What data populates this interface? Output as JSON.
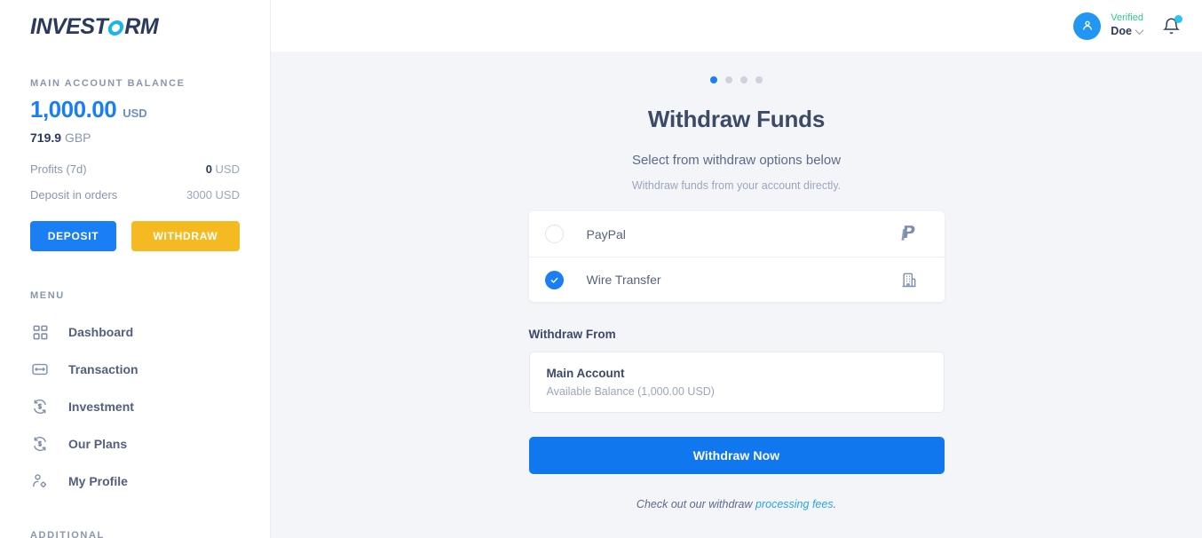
{
  "sidebar": {
    "logo": {
      "before": "INVEST",
      "ring": "O",
      "after": "RM"
    },
    "balance": {
      "label": "MAIN ACCOUNT BALANCE",
      "amount": "1,000.00",
      "currency": "USD",
      "secondary_amount": "719.9",
      "secondary_currency": "GBP"
    },
    "stats": [
      {
        "key": "Profits (7d)",
        "value": "0",
        "unit": "USD",
        "bold_value": true
      },
      {
        "key": "Deposit in orders",
        "value": "3000 USD",
        "unit": "",
        "bold_value": false
      }
    ],
    "actions": {
      "deposit": "DEPOSIT",
      "withdraw": "WITHDRAW"
    },
    "menu_label": "MENU",
    "menu": [
      {
        "label": "Dashboard",
        "icon": "grid-icon"
      },
      {
        "label": "Transaction",
        "icon": "exchange-icon"
      },
      {
        "label": "Investment",
        "icon": "refresh-dollar-icon"
      },
      {
        "label": "Our Plans",
        "icon": "refresh-dollar-icon"
      },
      {
        "label": "My Profile",
        "icon": "user-gear-icon"
      }
    ],
    "additional_label": "ADDITIONAL"
  },
  "header": {
    "status": "Verified",
    "username": "Doe",
    "avatar_icon": "user-icon",
    "bell_icon": "bell-icon"
  },
  "main": {
    "carousel": {
      "total": 4,
      "active_index": 0
    },
    "title": "Withdraw Funds",
    "subtitle": "Select from withdraw options below",
    "description": "Withdraw funds from your account directly.",
    "options": [
      {
        "label": "PayPal",
        "selected": false,
        "icon": "paypal-icon"
      },
      {
        "label": "Wire Transfer",
        "selected": true,
        "icon": "bank-building-icon"
      }
    ],
    "withdraw_from_label": "Withdraw From",
    "account": {
      "name": "Main Account",
      "balance_text": "Available Balance (1,000.00 USD)"
    },
    "submit_label": "Withdraw Now",
    "footnote_prefix": "Check out our withdraw ",
    "footnote_link": "processing fees",
    "footnote_suffix": "."
  },
  "colors": {
    "accent_blue": "#1a7ef5",
    "withdraw_amber": "#f5b921",
    "verified_green": "#2ecc88",
    "logo_cyan": "#17b4f0",
    "content_bg": "#f4f5f9"
  }
}
